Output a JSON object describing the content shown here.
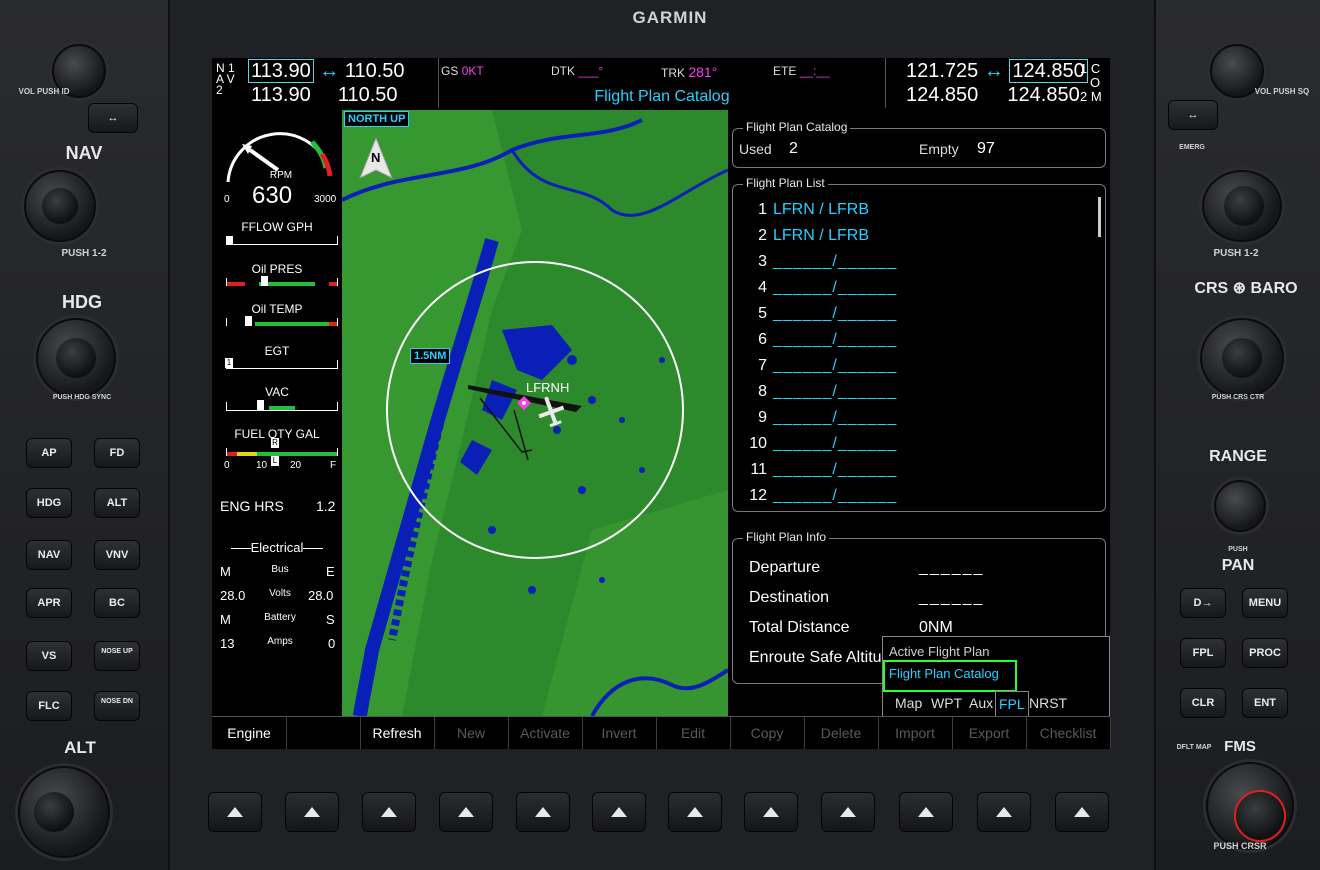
{
  "brand": "GARMIN",
  "top_bar": {
    "nav_label_line1": "N 1",
    "nav_label_line2": "A V 2",
    "nav1_active": "113.90",
    "nav1_standby": "110.50",
    "nav2_active": "113.90",
    "nav2_standby": "110.50",
    "gs_label": "GS",
    "gs_value": "0KT",
    "dtk_label": "DTK",
    "dtk_value": "___°",
    "trk_label": "TRK",
    "trk_value": "281°",
    "ete_label": "ETE",
    "ete_value": "__:__",
    "page_title": "Flight Plan Catalog",
    "com1_active": "121.725",
    "com1_standby": "124.850",
    "com2_active": "124.850",
    "com2_standby": "124.850",
    "com_label_line1": "1 C",
    "com_label_line2": "O",
    "com_label_line3": "2 M",
    "swap_arrow": "↔"
  },
  "engine": {
    "rpm_label": "RPM",
    "rpm_value": "630",
    "rpm_min": "0",
    "rpm_max": "3000",
    "fflow": "FFLOW GPH",
    "oil_pres": "Oil PRES",
    "oil_temp": "Oil TEMP",
    "egt": "EGT",
    "vac": "VAC",
    "fuel_qty": "FUEL QTY GAL",
    "fuel_ticks": [
      "0",
      "10",
      "20",
      "F"
    ],
    "fuel_marks": [
      "R",
      "L"
    ],
    "egt_mark": "1",
    "eng_hrs_label": "ENG HRS",
    "eng_hrs_value": "1.2",
    "electrical_title": "Electrical",
    "elec_left_1": "M",
    "elec_left_2": "28.0",
    "elec_left_3": "M",
    "elec_left_4": "13",
    "elec_mid_1": "Bus",
    "elec_mid_2": "Volts",
    "elec_mid_3": "Battery",
    "elec_mid_4": "Amps",
    "elec_right_1": "E",
    "elec_right_2": "28.0",
    "elec_right_3": "S",
    "elec_right_4": "0"
  },
  "map": {
    "orientation": "NORTH UP",
    "range": "1.5NM",
    "north_label": "N",
    "airport": "LFRNH"
  },
  "catalog": {
    "title": "Flight Plan Catalog",
    "used_label": "Used",
    "used_value": "2",
    "empty_label": "Empty",
    "empty_value": "97"
  },
  "plan_list": {
    "title": "Flight Plan List",
    "rows": [
      {
        "num": "1",
        "text": "LFRN / LFRB"
      },
      {
        "num": "2",
        "text": "LFRN / LFRB"
      },
      {
        "num": "3",
        "text": "______/______"
      },
      {
        "num": "4",
        "text": "______/______"
      },
      {
        "num": "5",
        "text": "______/______"
      },
      {
        "num": "6",
        "text": "______/______"
      },
      {
        "num": "7",
        "text": "______/______"
      },
      {
        "num": "8",
        "text": "______/______"
      },
      {
        "num": "9",
        "text": "______/______"
      },
      {
        "num": "10",
        "text": "______/______"
      },
      {
        "num": "11",
        "text": "______/______"
      },
      {
        "num": "12",
        "text": "______/______"
      }
    ]
  },
  "plan_info": {
    "title": "Flight Plan Info",
    "departure_label": "Departure",
    "departure_value": "______",
    "destination_label": "Destination",
    "destination_value": "______",
    "distance_label": "Total Distance",
    "distance_value": "0NM",
    "esa_label": "Enroute Safe Altitude"
  },
  "popup": {
    "item1": "Active Flight Plan",
    "item2": "Flight Plan Catalog",
    "tabs": [
      "Map",
      "WPT",
      "Aux",
      "FPL",
      "NRST"
    ],
    "selected_tab": "FPL"
  },
  "softkeys": [
    "Engine",
    "",
    "Refresh",
    "New",
    "Activate",
    "Invert",
    "Edit",
    "Copy",
    "Delete",
    "Import",
    "Export",
    "Checklist"
  ],
  "bezel": {
    "left": {
      "vol_label": "VOL",
      "vol_sub": "PUSH ID",
      "nav_label": "NAV",
      "nav_sub": "PUSH 1-2",
      "hdg_label": "HDG",
      "hdg_sub": "PUSH HDG SYNC",
      "alt_label": "ALT",
      "buttons": [
        "AP",
        "FD",
        "HDG",
        "ALT",
        "NAV",
        "VNV",
        "APR",
        "BC",
        "VS",
        "NOSE UP",
        "FLC",
        "NOSE DN"
      ]
    },
    "right": {
      "vol_label": "VOL",
      "vol_sub": "PUSH SQ",
      "emerg": "EMERG",
      "push12": "PUSH 1-2",
      "crs_baro": "CRS",
      "baro": "BARO",
      "crs_sub": "PUSH CRS CTR",
      "range": "RANGE",
      "pan_push": "PUSH",
      "pan": "PAN",
      "buttons": [
        "D→",
        "MENU",
        "FPL",
        "PROC",
        "CLR",
        "ENT"
      ],
      "dfltmap": "DFLT MAP",
      "fms": "FMS",
      "push_crsr": "PUSH CRSR"
    }
  },
  "colors": {
    "cyan": "#26d0ff",
    "magenta": "#ff3cf0",
    "map_land": "#2d8a2c",
    "map_water": "#0a1fb8",
    "selection": "#2bff2b"
  }
}
